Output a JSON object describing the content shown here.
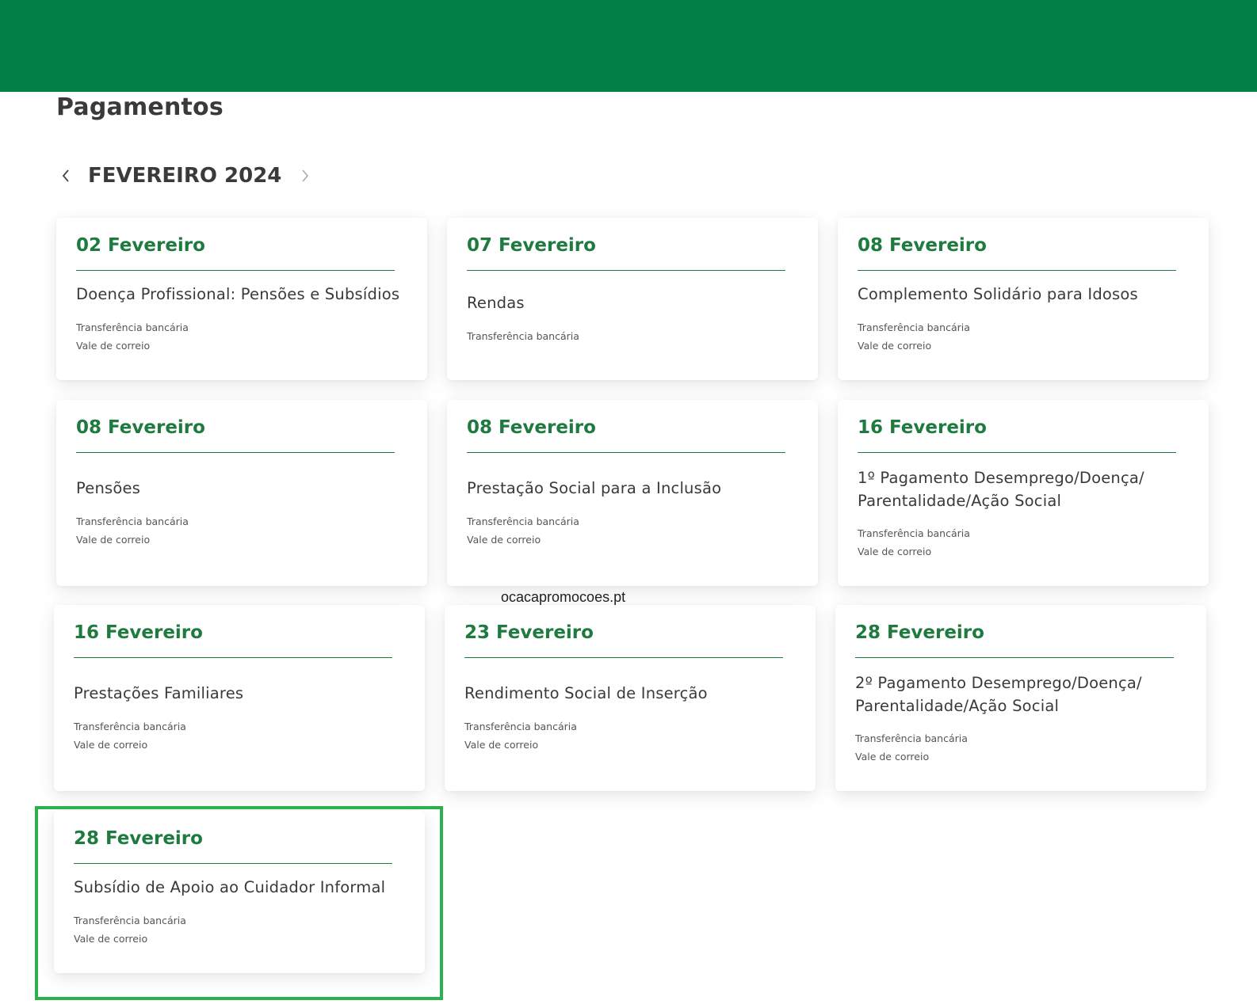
{
  "header": {
    "title": "Pagamentos"
  },
  "month_nav": {
    "label": "FEVEREIRO 2024",
    "prev_icon": "chevron-left-icon",
    "next_icon": "chevron-right-icon"
  },
  "colors": {
    "brand_green": "#008045",
    "date_green": "#1f7a3f",
    "highlight_green": "#2db14f"
  },
  "cards": [
    {
      "date": "02 Fevereiro",
      "title": "Doença Profissional: Pensões e Subsídios",
      "methods": [
        "Transferência bancária",
        "Vale de correio"
      ]
    },
    {
      "date": "07 Fevereiro",
      "title": "Rendas",
      "methods": [
        "Transferência bancária"
      ]
    },
    {
      "date": "08 Fevereiro",
      "title": "Complemento Solidário para Idosos",
      "methods": [
        "Transferência bancária",
        "Vale de correio"
      ]
    },
    {
      "date": "08 Fevereiro",
      "title": "Pensões",
      "methods": [
        "Transferência bancária",
        "Vale de correio"
      ]
    },
    {
      "date": "08 Fevereiro",
      "title": "Prestação Social para a Inclusão",
      "methods": [
        "Transferência bancária",
        "Vale de correio"
      ]
    },
    {
      "date": "16 Fevereiro",
      "title": "1º Pagamento Desemprego/Doença/ Parentalidade/Ação Social",
      "methods": [
        "Transferência bancária",
        "Vale de correio"
      ]
    },
    {
      "date": "16 Fevereiro",
      "title": "Prestações Familiares",
      "methods": [
        "Transferência bancária",
        "Vale de correio"
      ]
    },
    {
      "date": "23 Fevereiro",
      "title": "Rendimento Social de Inserção",
      "methods": [
        "Transferência bancária",
        "Vale de correio"
      ]
    },
    {
      "date": "28 Fevereiro",
      "title": "2º Pagamento Desemprego/Doença/ Parentalidade/Ação Social",
      "methods": [
        "Transferência bancária",
        "Vale de correio"
      ]
    },
    {
      "date": "28 Fevereiro",
      "title": "Subsídio de Apoio ao Cuidador Informal",
      "methods": [
        "Transferência bancária",
        "Vale de correio"
      ]
    }
  ],
  "watermark": "ocacapromocoes.pt"
}
